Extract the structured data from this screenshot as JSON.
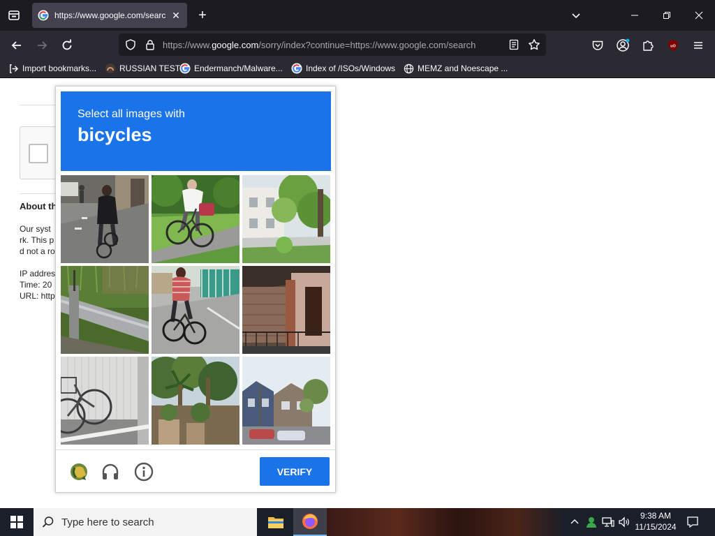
{
  "browser": {
    "tab_title": "https://www.google.com/searc",
    "url_prefix": "https://www.",
    "url_domain": "google.com",
    "url_rest": "/sorry/index?continue=https://www.google.com/search",
    "bookmarks": [
      {
        "label": "Import bookmarks...",
        "icon": "import-icon"
      },
      {
        "label": "RUSSIAN TEST",
        "icon": "rss-icon"
      },
      {
        "label": "Endermanch/Malware...",
        "icon": "google-favicon"
      },
      {
        "label": "Index of /ISOs/Windows",
        "icon": "google-favicon"
      },
      {
        "label": "MEMZ and Noescape ...",
        "icon": "globe-icon"
      }
    ]
  },
  "page": {
    "about_heading": "About th",
    "lines": [
      "Our syst",
      "rk. This p",
      "d not a ro",
      "IP addres",
      "Time: 20",
      "URL: http"
    ]
  },
  "challenge": {
    "instruction": "Select all images with",
    "object": "bicycles",
    "tiles": [
      {
        "scene": "man-riding-bicycle-on-street"
      },
      {
        "scene": "person-riding-bicycle-on-path"
      },
      {
        "scene": "house-and-tree"
      },
      {
        "scene": "guardrail-and-grass"
      },
      {
        "scene": "person-riding-bicycle-on-road"
      },
      {
        "scene": "brick-building-with-fence"
      },
      {
        "scene": "parked-bicycle-by-wall"
      },
      {
        "scene": "palm-trees"
      },
      {
        "scene": "houses-and-street"
      }
    ],
    "verify_label": "VERIFY"
  },
  "taskbar": {
    "search_placeholder": "Type here to search",
    "time": "9:38 AM",
    "date": "11/15/2024"
  },
  "colors": {
    "accent": "#1a73e8",
    "chrome_dark": "#1c1b22",
    "chrome_toolbar": "#2b2a33",
    "taskbar": "#1b1f2a"
  }
}
